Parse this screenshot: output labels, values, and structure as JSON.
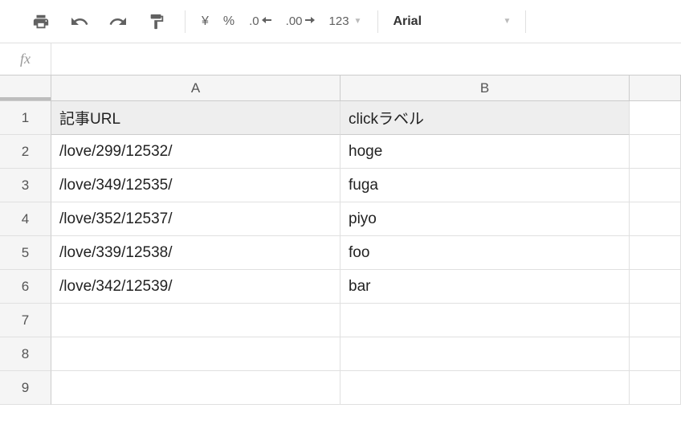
{
  "toolbar": {
    "currency": "¥",
    "percent": "%",
    "decrease_decimal": ".0",
    "increase_decimal": ".00",
    "format_number": "123",
    "font": "Arial"
  },
  "formula": {
    "fx": "fx",
    "value": ""
  },
  "columns": [
    "A",
    "B"
  ],
  "rows": [
    "1",
    "2",
    "3",
    "4",
    "5",
    "6",
    "7",
    "8",
    "9"
  ],
  "cells": {
    "A1": "記事URL",
    "B1": "clickラベル",
    "A2": "/love/299/12532/",
    "B2": "hoge",
    "A3": "/love/349/12535/",
    "B3": "fuga",
    "A4": "/love/352/12537/",
    "B4": "piyo",
    "A5": "/love/339/12538/",
    "B5": "foo",
    "A6": "/love/342/12539/",
    "B6": "bar",
    "A7": "",
    "B7": "",
    "A8": "",
    "B8": "",
    "A9": "",
    "B9": ""
  }
}
